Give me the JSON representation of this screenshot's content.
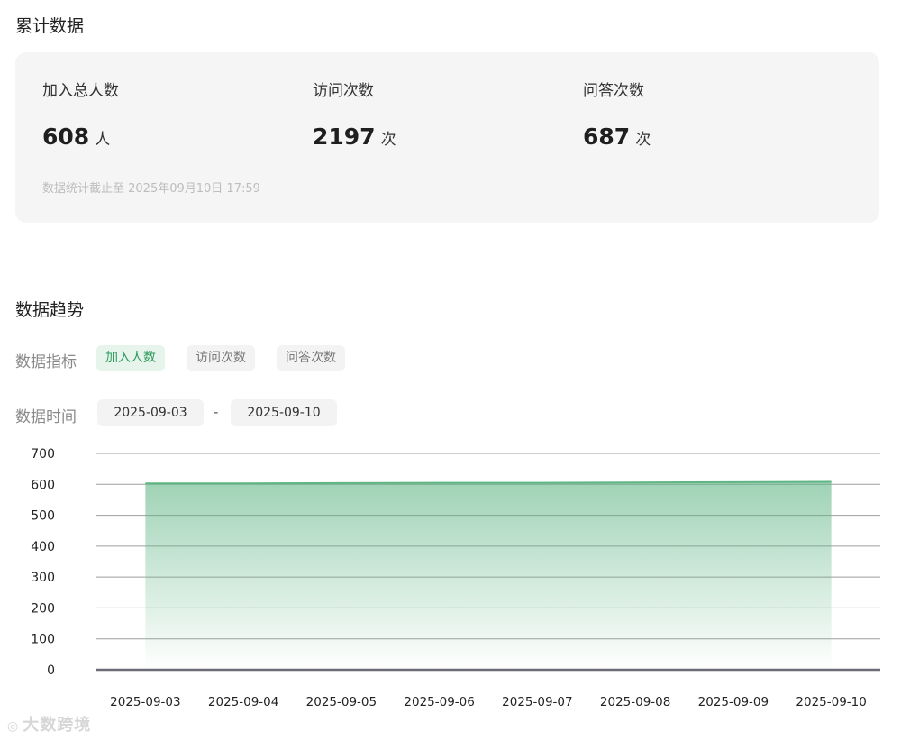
{
  "cumulative": {
    "title": "累计数据",
    "stats": [
      {
        "label": "加入总人数",
        "value": "608",
        "unit": "人"
      },
      {
        "label": "访问次数",
        "value": "2197",
        "unit": "次"
      },
      {
        "label": "问答次数",
        "value": "687",
        "unit": "次"
      }
    ],
    "note": "数据统计截止至 2025年09月10日 17:59"
  },
  "trend": {
    "title": "数据趋势",
    "metric_label": "数据指标",
    "metrics": [
      "加入人数",
      "访问次数",
      "问答次数"
    ],
    "active_metric": "加入人数",
    "time_label": "数据时间",
    "date_start": "2025-09-03",
    "date_separator": "-",
    "date_end": "2025-09-10"
  },
  "chart_data": {
    "type": "area",
    "categories": [
      "2025-09-03",
      "2025-09-04",
      "2025-09-05",
      "2025-09-06",
      "2025-09-07",
      "2025-09-08",
      "2025-09-09",
      "2025-09-10"
    ],
    "values": [
      603,
      603,
      604,
      605,
      605,
      606,
      607,
      608
    ],
    "yticks": [
      0,
      100,
      200,
      300,
      400,
      500,
      600,
      700
    ],
    "ylim": [
      0,
      700
    ],
    "grid": true,
    "series_color": "#5fb584"
  },
  "watermark": {
    "icon": "brand-logo-icon",
    "text": "大数跨境"
  }
}
